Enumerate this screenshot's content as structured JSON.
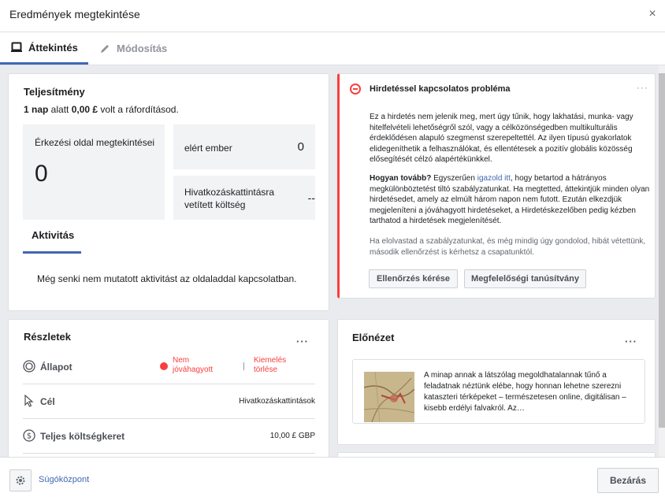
{
  "window": {
    "title": "Eredmények megtekintése",
    "close_icon": "×"
  },
  "tabs": [
    {
      "label": "Áttekintés",
      "icon": "tablet-icon",
      "active": true
    },
    {
      "label": "Módosítás",
      "icon": "pencil-icon",
      "active": false
    }
  ],
  "performance": {
    "title": "Teljesítmény",
    "spend_prefix": "1 nap",
    "spend_middle": " alatt ",
    "spend_amount": "0,00 £",
    "spend_suffix": " volt a ráfordításod.",
    "landing_label": "Érkezési oldal megtekintései",
    "landing_value": "0",
    "reached_label": "elért ember",
    "reached_value": "0",
    "cost_label": "Hivatkozáskattintásra vetített költség",
    "cost_value": "--",
    "activity_tab": "Aktivitás",
    "activity_message": "Még senki nem mutatott aktivitást az oldaladdal kapcsolatban."
  },
  "problem": {
    "title": "Hirdetéssel kapcsolatos probléma",
    "menu": "···",
    "paragraph1": "Ez a hirdetés nem jelenik meg, mert úgy tűnik, hogy lakhatási, munka- vagy hitelfelvételi lehetőségről szól, vagy a célközönségedben multikulturális érdeklődésen alapuló szegmenst szerepeltettél. Az ilyen típusú gyakorlatok elidegeníthetik a felhasználókat, és ellentétesek a pozitív globális közösség elősegítését célzó alapértékünkkel.",
    "p2_lead": "Hogyan tovább?",
    "p2_a": " Egyszerűen ",
    "p2_link": "igazold itt",
    "p2_b": ", hogy betartod a hátrányos megkülönböztetést tiltó szabályzatunkat. Ha megtetted, áttekintjük minden olyan hirdetésedet, amely az elmúlt három napon nem futott. Ezután elkezdjük megjeleníteni a jóváhagyott hirdetéseket, a Hirdetéskezelőben pedig kézben tarthatod a hirdetések megjelenítését.",
    "paragraph3": "Ha elolvastad a szabályzatunkat, és még mindig úgy gondolod, hibát vétettünk, második ellenőrzést is kérhetsz a csapatunktól.",
    "btn_review": "Ellenőrzés kérése",
    "btn_cert": "Megfelelőségi tanúsítvány"
  },
  "details": {
    "title": "Részletek",
    "menu": "···",
    "status_label": "Állapot",
    "status_value": "Nem jóváhagyott",
    "status_action": "Kiemelés törlése",
    "goal_label": "Cél",
    "goal_value": "Hivatkozáskattintások",
    "budget_label": "Teljes költségkeret",
    "budget_value": "10,00 £ GBP"
  },
  "preview": {
    "title": "Előnézet",
    "menu": "···",
    "text": "A minap annak a látszólag megoldhatalannak tűnő a feladatnak néztünk elébe, hogy honnan lehetne szerezni kataszteri térképeket – természetesen online, digitálisan – kisebb erdélyi falvakról. Az…"
  },
  "footer": {
    "help": "Súgóközpont",
    "close": "Bezárás"
  },
  "colors": {
    "accent": "#4267b2",
    "error": "#fa3e3e",
    "bg": "#e9ebee"
  }
}
